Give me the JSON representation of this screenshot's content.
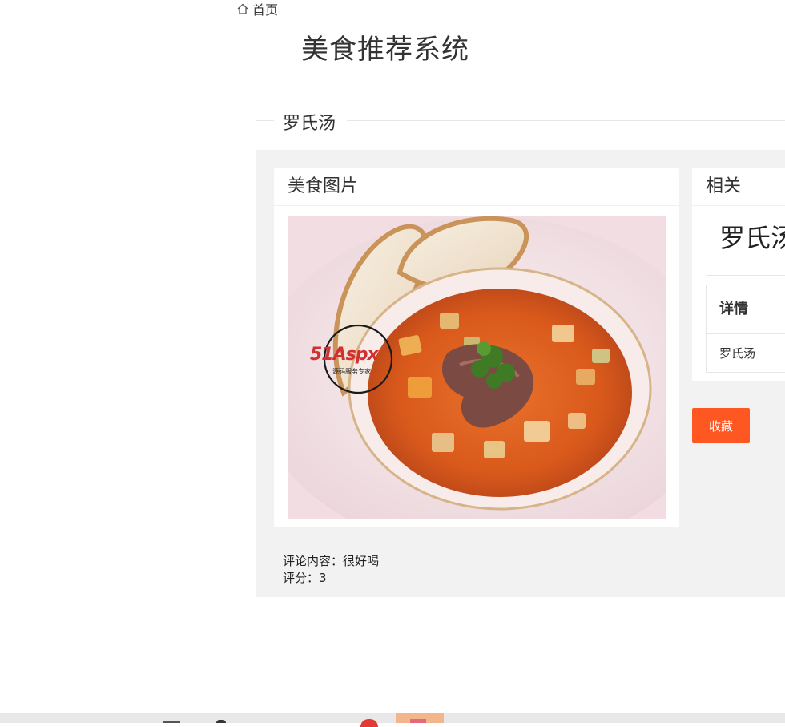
{
  "breadcrumb": {
    "home_label": "首页"
  },
  "site_title": "美食推荐系统",
  "section": {
    "title": "罗氏汤"
  },
  "image_card": {
    "title": "美食图片",
    "watermark": {
      "brand": "51Aspx",
      "tagline": "源码服务专家"
    }
  },
  "related_card": {
    "title": "相关",
    "food_name": "罗氏汤",
    "detail_header": "详情",
    "detail_value": "罗氏汤"
  },
  "favorite_button": {
    "label": "收藏"
  },
  "comments": [
    {
      "content_label": "评论内容：",
      "content": "很好喝",
      "score_label": "评分：",
      "score": "3"
    }
  ],
  "colors": {
    "accent": "#ff5722",
    "panel_bg": "#f2f2f2",
    "card_bg": "#ffffff"
  }
}
